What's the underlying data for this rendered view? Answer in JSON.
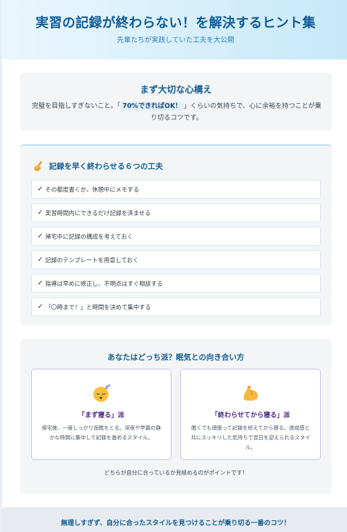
{
  "header": {
    "title": "実習の記録が終わらない！を解決するヒント集",
    "subtitle": "先輩たちが実践していた工夫を大公開"
  },
  "mindset": {
    "title": "まず大切な心構え",
    "text_before": "完璧を目指しすぎないこと。「",
    "highlight": "70%できればOK！",
    "text_after": "」くらいの気持ちで、心に余裕を持つことが乗り切るコツです。"
  },
  "tips": {
    "icon": "writing-hand-icon",
    "title": "記録を早く終わらせる６つの工夫",
    "check_mark": "✓",
    "items": [
      "その都度書くか、休憩中にメモする",
      "実習時間内にできるだけ記録を済ませる",
      "帰宅中に記録の構成を考えておく",
      "記録のテンプレートを用意しておく",
      "指導は早めに修正し、不明点はすぐ相談する",
      "「〇時まで！」と時間を決めて集中する"
    ]
  },
  "types": {
    "title": "あなたはどっち派？眠気との向き合い方",
    "left": {
      "icon": "sleeping-face-icon",
      "name": "「まず寝る」派",
      "desc": "帰宅後、一度しっかり仮眠をとる。深夜や早朝の静かな時間に集中して記録を進めるスタイル。"
    },
    "right": {
      "icon": "flexed-biceps-icon",
      "name": "「終わらせてから寝る」派",
      "desc": "眠くても頑張って記録を終えてから寝る。達成感と共にスッキリした気持ちで翌日を迎えられるスタイル。"
    },
    "note": "どちらが自分に合っているか見極めるのがポイントです！"
  },
  "footer": {
    "text": "無理しすぎず、自分に合ったスタイルを見つけることが乗り切る一番のコツ！"
  }
}
